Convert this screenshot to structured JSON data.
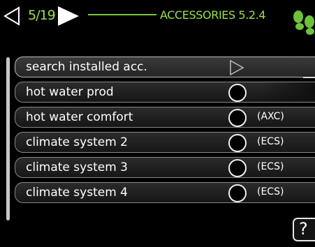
{
  "header": {
    "page_counter": "5/19",
    "menu_title": "ACCESSORIES 5.2.4",
    "icons": {
      "prev": "arrow-left-outline-icon",
      "next": "arrow-right-filled-icon",
      "logo": "footprints-logo-icon"
    },
    "accent_color": "#9de04a"
  },
  "list": {
    "items": [
      {
        "label": "search installed acc.",
        "control": "arrow",
        "suffix": ""
      },
      {
        "label": "hot water prod",
        "control": "radio",
        "suffix": ""
      },
      {
        "label": "hot water comfort",
        "control": "radio",
        "suffix": "(AXC)"
      },
      {
        "label": "climate system 2",
        "control": "radio",
        "suffix": "(ECS)"
      },
      {
        "label": "climate system 3",
        "control": "radio",
        "suffix": "(ECS)"
      },
      {
        "label": "climate system 4",
        "control": "radio",
        "suffix": "(ECS)"
      }
    ]
  },
  "help": {
    "glyph": "?"
  }
}
